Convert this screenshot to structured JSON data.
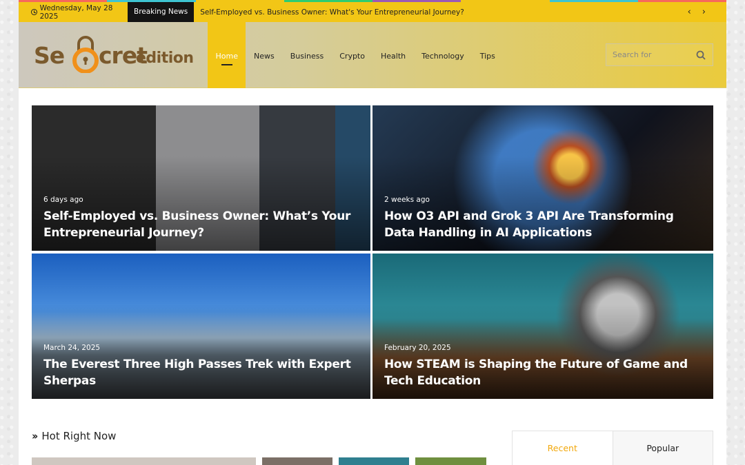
{
  "colors": {
    "accent": "#f2c616",
    "dark": "#141414",
    "colorbar": [
      "#f7685b",
      "#3ec4d1",
      "#f2c616",
      "#2ecc71",
      "#9b59b6",
      "#f2c616",
      "#3ec4d1",
      "#f7685b"
    ]
  },
  "topbar": {
    "date": "Wednesday, May 28 2025",
    "breaking_label": "Breaking News",
    "ticker": "Self-Employed vs. Business Owner: What's Your Entrepreneurial Journey?",
    "prev_arrow": "‹",
    "next_arrow": "›"
  },
  "logo": {
    "text_left": "Se",
    "text_right": "cret",
    "text_small": "edition"
  },
  "nav": {
    "items": [
      {
        "label": "Home",
        "active": true
      },
      {
        "label": "News"
      },
      {
        "label": "Business"
      },
      {
        "label": "Crypto"
      },
      {
        "label": "Health"
      },
      {
        "label": "Technology"
      },
      {
        "label": "Tips"
      }
    ]
  },
  "search": {
    "placeholder": "Search for",
    "icon": "search-icon"
  },
  "featured": [
    {
      "meta": "6 days ago",
      "title": "Self-Employed vs. Business Owner: What’s Your Entrepreneurial Journey?"
    },
    {
      "meta": "2 weeks ago",
      "title": "How O3 API and Grok 3 API Are Transforming Data Handling in AI Applications"
    },
    {
      "meta": "March 24, 2025",
      "title": "The Everest Three High Passes Trek with Expert Sherpas"
    },
    {
      "meta": "February 20, 2025",
      "title": "How STEAM is Shaping the Future of Game and Tech Education"
    }
  ],
  "hot": {
    "title": "Hot Right Now"
  },
  "sidebar_tabs": {
    "recent": "Recent",
    "popular": "Popular"
  }
}
